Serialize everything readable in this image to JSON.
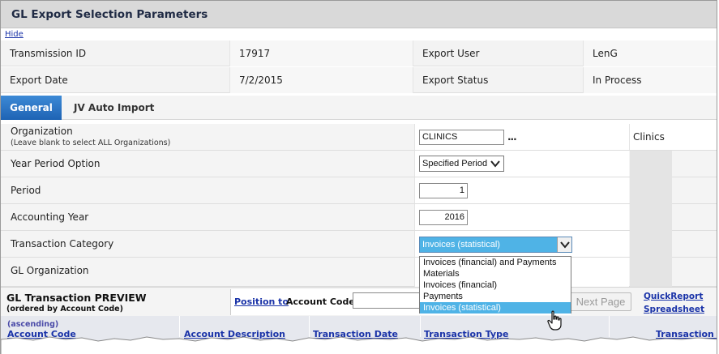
{
  "panel": {
    "title": "GL Export Selection Parameters",
    "hide_label": "Hide"
  },
  "info": {
    "transmission_id_label": "Transmission ID",
    "transmission_id_value": "17917",
    "export_user_label": "Export User",
    "export_user_value": "LenG",
    "export_date_label": "Export Date",
    "export_date_value": "7/2/2015",
    "export_status_label": "Export Status",
    "export_status_value": "In Process"
  },
  "tabs": [
    {
      "label": "General",
      "active": true
    },
    {
      "label": "JV Auto Import",
      "active": false
    }
  ],
  "form": {
    "organization_label": "Organization",
    "organization_hint": "(Leave blank to select ALL Organizations)",
    "organization_value": "CLINICS",
    "organization_lookup": "...",
    "organization_desc": "Clinics",
    "year_period_label": "Year Period Option",
    "year_period_value": "Specified Period",
    "period_label": "Period",
    "period_value": "1",
    "accounting_year_label": "Accounting Year",
    "accounting_year_value": "2016",
    "transaction_category_label": "Transaction Category",
    "transaction_category_value": "Invoices (statistical)",
    "gl_organization_label": "GL Organization"
  },
  "dropdown": {
    "options": [
      "Invoices (financial) and Payments",
      "Materials",
      "Invoices (financial)",
      "Payments",
      "Invoices (statistical)"
    ],
    "selected_index": 4
  },
  "preview": {
    "title": "GL Transaction PREVIEW",
    "subtitle": "(ordered by Account Code)",
    "position_to": "Position to",
    "account_code_label": "Account Code",
    "next_page": "Next Page",
    "quick_report": "QuickReport",
    "spreadsheet": "Spreadsheet"
  },
  "grid": {
    "sort_note": "(ascending)",
    "columns": [
      "Account Code",
      "Account Description",
      "Transaction Date",
      "Transaction Type",
      "Transaction Am"
    ]
  },
  "colors": {
    "tab_active": "#1e63b4",
    "link": "#1a33a8",
    "selection": "#4fb3e6"
  },
  "icons": {
    "lookup": "ellipsis-icon",
    "select_arrow": "chevron-down-icon",
    "cursor": "hand-pointer-icon"
  }
}
